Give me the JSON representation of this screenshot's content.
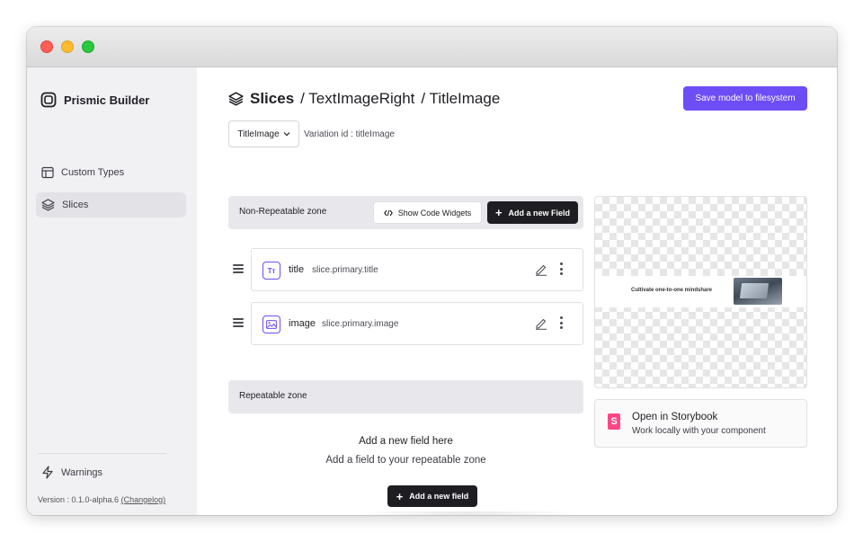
{
  "window": {
    "controls": [
      "close",
      "minimize",
      "zoom"
    ]
  },
  "sidebar": {
    "brand": "Prismic Builder",
    "items": [
      {
        "label": "Custom Types",
        "icon": "layout-icon",
        "active": false
      },
      {
        "label": "Slices",
        "icon": "layers-icon",
        "active": true
      }
    ],
    "warnings_label": "Warnings",
    "version_text": "Version : 0.1.0-alpha.6",
    "changelog_label": "(Changelog)"
  },
  "header": {
    "title": "Slices",
    "breadcrumb_1": "/ TextImageRight",
    "breadcrumb_2": "/ TitleImage",
    "save_label": "Save model to filesystem"
  },
  "variation": {
    "selected": "TitleImage",
    "id_text": "Variation id : titleImage"
  },
  "non_repeatable": {
    "label": "Non-Repeatable zone",
    "show_code_label": "Show Code Widgets",
    "add_field_label": "Add a new Field",
    "fields": [
      {
        "name": "title",
        "api": "slice.primary.title",
        "icon": "rich-text-icon",
        "icon_text": "Tт"
      },
      {
        "name": "image",
        "api": "slice.primary.image",
        "icon": "image-icon",
        "icon_text": ""
      }
    ]
  },
  "repeatable": {
    "label": "Repeatable zone",
    "empty_title": "Add a new field here",
    "empty_sub": "Add a field to your repeatable zone",
    "add_field_label": "Add a new field"
  },
  "preview": {
    "text": "Cultivate one-to-one mindshare"
  },
  "storybook": {
    "title": "Open in Storybook",
    "subtitle": "Work locally with your component",
    "icon_text": "S"
  },
  "colors": {
    "accent": "#6d4df6",
    "dark_button": "#1e1e22",
    "sidebar_bg": "#f1f1f4",
    "storybook_pink": "#ff4785"
  }
}
